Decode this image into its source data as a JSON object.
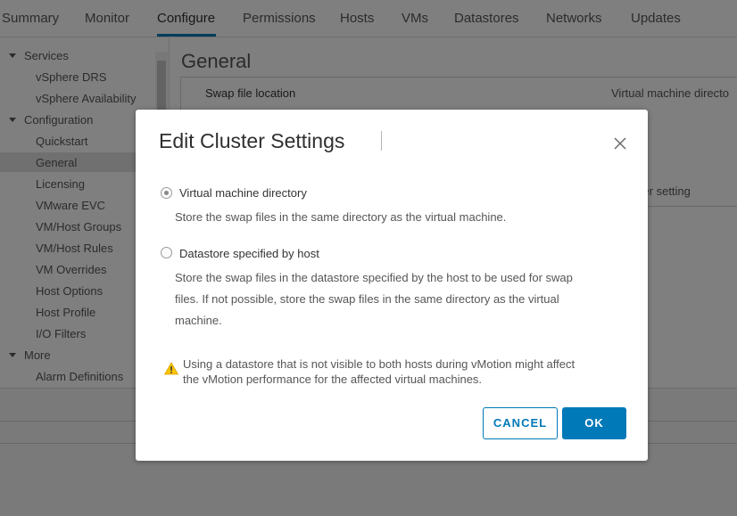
{
  "tabs": [
    {
      "label": "Summary"
    },
    {
      "label": "Monitor"
    },
    {
      "label": "Configure"
    },
    {
      "label": "Permissions"
    },
    {
      "label": "Hosts"
    },
    {
      "label": "VMs"
    },
    {
      "label": "Datastores"
    },
    {
      "label": "Networks"
    },
    {
      "label": "Updates"
    }
  ],
  "active_tab": "Configure",
  "accent_color": "#0079b8",
  "sidebar": {
    "services": {
      "label": "Services",
      "items": [
        "vSphere DRS",
        "vSphere Availability"
      ]
    },
    "configuration": {
      "label": "Configuration",
      "items": [
        "Quickstart",
        "General",
        "Licensing",
        "VMware EVC",
        "VM/Host Groups",
        "VM/Host Rules",
        "VM Overrides",
        "Host Options",
        "Host Profile",
        "I/O Filters"
      ]
    },
    "more": {
      "label": "More",
      "items": [
        "Alarm Definitions"
      ]
    },
    "selected": "General"
  },
  "content": {
    "title": "General",
    "property_label": "Swap file location",
    "property_value": "Virtual machine directo",
    "property_value_2": "tacenter setting"
  },
  "dialog": {
    "title": "Edit Cluster Settings",
    "options": [
      {
        "label": "Virtual machine directory",
        "description": "Store the swap files in the same directory as the virtual machine.",
        "checked": true
      },
      {
        "label": "Datastore specified by host",
        "description_lines": [
          "Store the swap files in the datastore specified by the host to be used for swap",
          "files. If not possible, store the swap files in the same directory as the virtual",
          "machine."
        ],
        "checked": false
      }
    ],
    "warning_lines": [
      "Using a datastore that is not visible to both hosts during vMotion might affect",
      "the vMotion performance for the affected virtual machines."
    ],
    "warning_icon": "warning-triangle-icon",
    "cancel_label": "CANCEL",
    "ok_label": "OK"
  }
}
